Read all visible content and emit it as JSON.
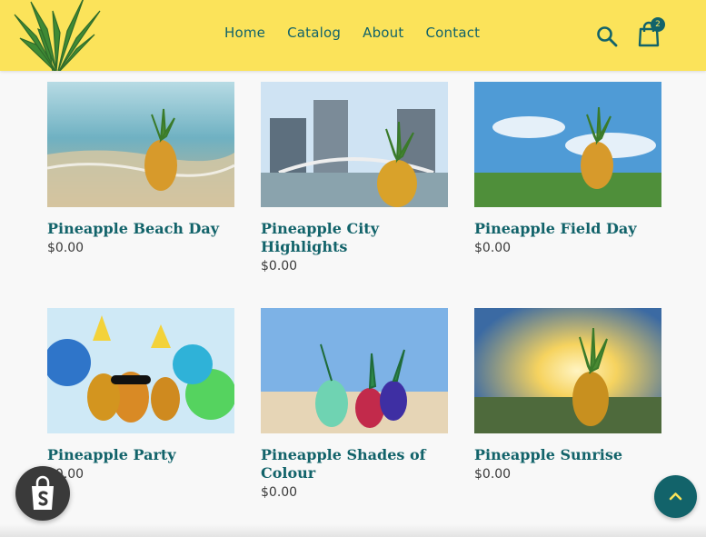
{
  "nav": {
    "items": [
      "Home",
      "Catalog",
      "About",
      "Contact"
    ]
  },
  "cart": {
    "count": "2"
  },
  "products": [
    {
      "title": "Pineapple Beach Day",
      "price": "$0.00"
    },
    {
      "title": "Pineapple City Highlights",
      "price": "$0.00"
    },
    {
      "title": "Pineapple Field Day",
      "price": "$0.00"
    },
    {
      "title": "Pineapple Party",
      "price": "$0.00"
    },
    {
      "title": "Pineapple Shades of Colour",
      "price": "$0.00"
    },
    {
      "title": "Pineapple Sunrise",
      "price": "$0.00"
    }
  ],
  "colors": {
    "header_bg": "#fbe35a",
    "accent": "#12636a",
    "price_text": "#3a3a3a"
  },
  "icons": {
    "logo": "pineapple-crown-logo",
    "search": "search-icon",
    "cart": "shopping-bag-icon",
    "shopify": "shopify-bag-icon",
    "back_to_top": "chevron-up-icon"
  }
}
